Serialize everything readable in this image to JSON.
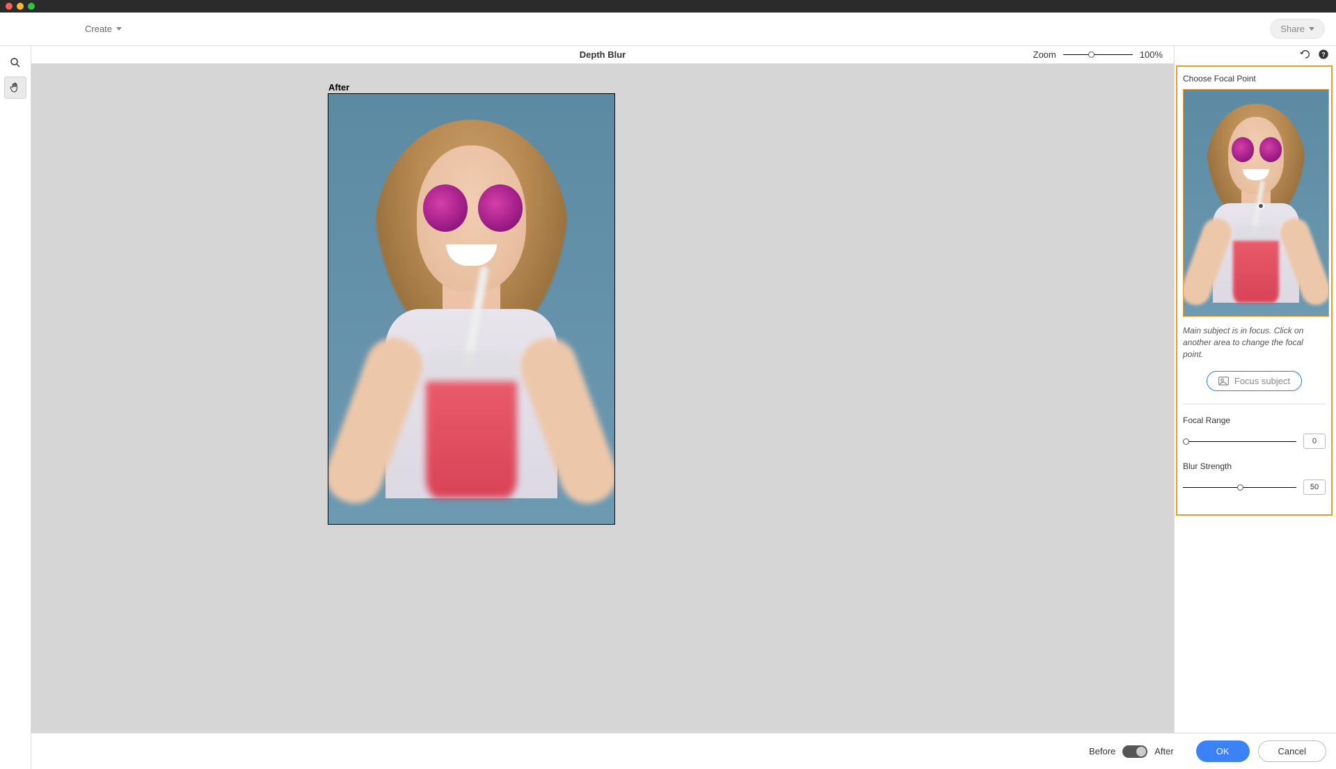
{
  "topbar": {
    "create_label": "Create",
    "share_label": "Share"
  },
  "canvas": {
    "title": "Depth Blur",
    "zoom_label": "Zoom",
    "zoom_value": "100%",
    "after_label": "After"
  },
  "panel": {
    "title": "Choose Focal Point",
    "hint": "Main subject is in focus. Click on another area to change the focal point.",
    "focus_btn": "Focus subject",
    "focal_range_label": "Focal Range",
    "focal_range_value": "0",
    "blur_strength_label": "Blur Strength",
    "blur_strength_value": "50"
  },
  "footer": {
    "before_label": "Before",
    "after_label": "After",
    "ok": "OK",
    "cancel": "Cancel"
  }
}
